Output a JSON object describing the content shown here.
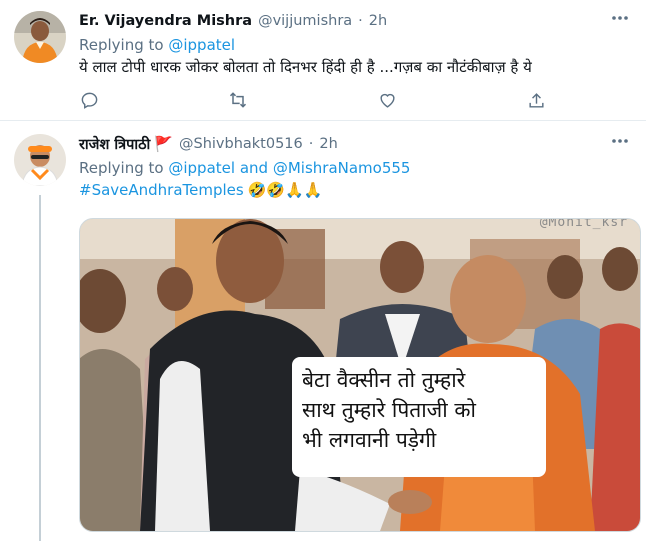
{
  "tweets": [
    {
      "author_name": "Er. Vijayendra Mishra",
      "handle": "@vijjumishra",
      "separator": "·",
      "time": "2h",
      "replying_prefix": "Replying to",
      "replying_to": "@ippatel",
      "text": "ये लाल टोपी धारक जोकर बोलता तो दिनभर हिंदी ही है ...गज़ब का नौटंकीबाज़ है ये",
      "more_icon": "more-dots-icon",
      "actions": [
        "reply-icon",
        "retweet-icon",
        "like-icon",
        "share-icon"
      ]
    },
    {
      "author_name": "राजेश त्रिपाठी",
      "flag": "🚩",
      "handle": "@Shivbhakt0516",
      "separator": "·",
      "time": "2h",
      "replying_prefix": "Replying to",
      "replying_to_1": "@ippatel",
      "replying_and": "and",
      "replying_to_2": "@MishraNamo555",
      "hashtag": "#SaveAndhraTemples",
      "emojis": "🤣🤣🙏🙏",
      "more_icon": "more-dots-icon",
      "media": {
        "watermark": "@Mohit_ksr",
        "caption_line1": "बेटा वैक्सीन तो तुम्हारे",
        "caption_line2": "साथ तुम्हारे पिताजी को",
        "caption_line3": "भी लगवानी पड़ेगी"
      }
    }
  ],
  "colors": {
    "accent": "#1b95e0",
    "secondary_text": "#5b7083",
    "divider": "#e6ecf0",
    "flag": "#e0245e"
  }
}
